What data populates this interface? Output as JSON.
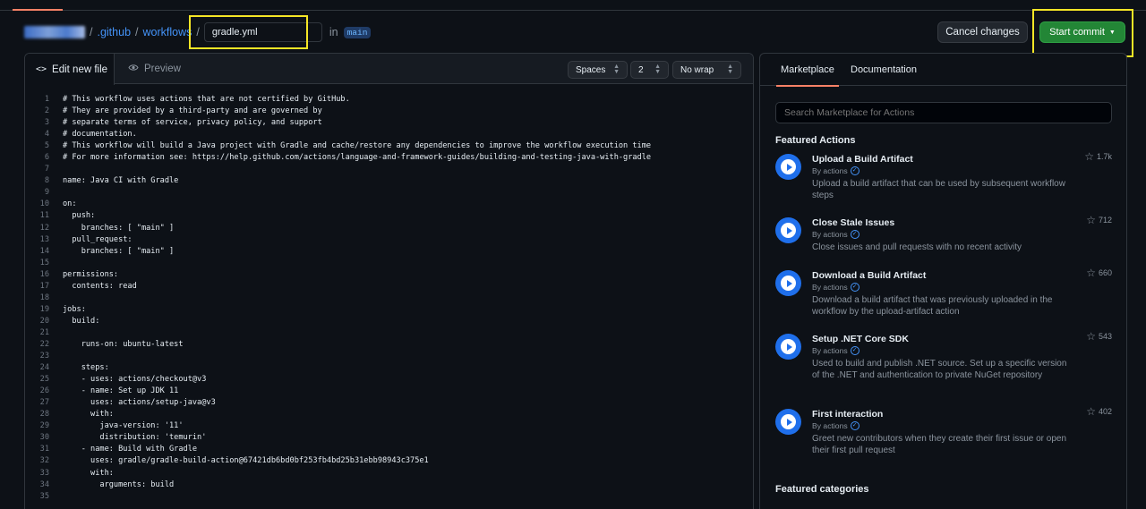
{
  "breadcrumb": {
    "repo": "",
    "path": [
      ".github",
      "workflows"
    ],
    "filename": "gradle.yml",
    "in_label": "in",
    "branch": "main"
  },
  "header": {
    "cancel_label": "Cancel changes",
    "commit_label": "Start commit"
  },
  "editor": {
    "tabs": {
      "edit": "Edit new file",
      "preview": "Preview"
    },
    "indent_mode": "Spaces",
    "indent_size": "2",
    "wrap_mode": "No wrap",
    "lines": [
      "# This workflow uses actions that are not certified by GitHub.",
      "# They are provided by a third-party and are governed by",
      "# separate terms of service, privacy policy, and support",
      "# documentation.",
      "# This workflow will build a Java project with Gradle and cache/restore any dependencies to improve the workflow execution time",
      "# For more information see: https://help.github.com/actions/language-and-framework-guides/building-and-testing-java-with-gradle",
      "",
      "name: Java CI with Gradle",
      "",
      "on:",
      "  push:",
      "    branches: [ \"main\" ]",
      "  pull_request:",
      "    branches: [ \"main\" ]",
      "",
      "permissions:",
      "  contents: read",
      "",
      "jobs:",
      "  build:",
      "",
      "    runs-on: ubuntu-latest",
      "",
      "    steps:",
      "    - uses: actions/checkout@v3",
      "    - name: Set up JDK 11",
      "      uses: actions/setup-java@v3",
      "      with:",
      "        java-version: '11'",
      "        distribution: 'temurin'",
      "    - name: Build with Gradle",
      "      uses: gradle/gradle-build-action@67421db6bd0bf253fb4bd25b31ebb98943c375e1",
      "      with:",
      "        arguments: build",
      ""
    ]
  },
  "sidebar": {
    "tabs": {
      "marketplace": "Marketplace",
      "documentation": "Documentation"
    },
    "search_placeholder": "Search Marketplace for Actions",
    "featured_actions_title": "Featured Actions",
    "featured_categories_title": "Featured categories",
    "actions": [
      {
        "title": "Upload a Build Artifact",
        "by": "By actions",
        "desc": "Upload a build artifact that can be used by subsequent workflow steps",
        "stars": "1.7k"
      },
      {
        "title": "Close Stale Issues",
        "by": "By actions",
        "desc": "Close issues and pull requests with no recent activity",
        "stars": "712"
      },
      {
        "title": "Download a Build Artifact",
        "by": "By actions",
        "desc": "Download a build artifact that was previously uploaded in the workflow by the upload-artifact action",
        "stars": "660"
      },
      {
        "title": "Setup .NET Core SDK",
        "by": "By actions",
        "desc": "Used to build and publish .NET source. Set up a specific version of the .NET and authentication to private NuGet repository",
        "stars": "543"
      },
      {
        "title": "First interaction",
        "by": "By actions",
        "desc": "Greet new contributors when they create their first issue or open their first pull request",
        "stars": "402"
      }
    ]
  },
  "colors": {
    "accent_green": "#238636",
    "highlight_yellow": "#f5e626",
    "link_blue": "#4493f8"
  }
}
